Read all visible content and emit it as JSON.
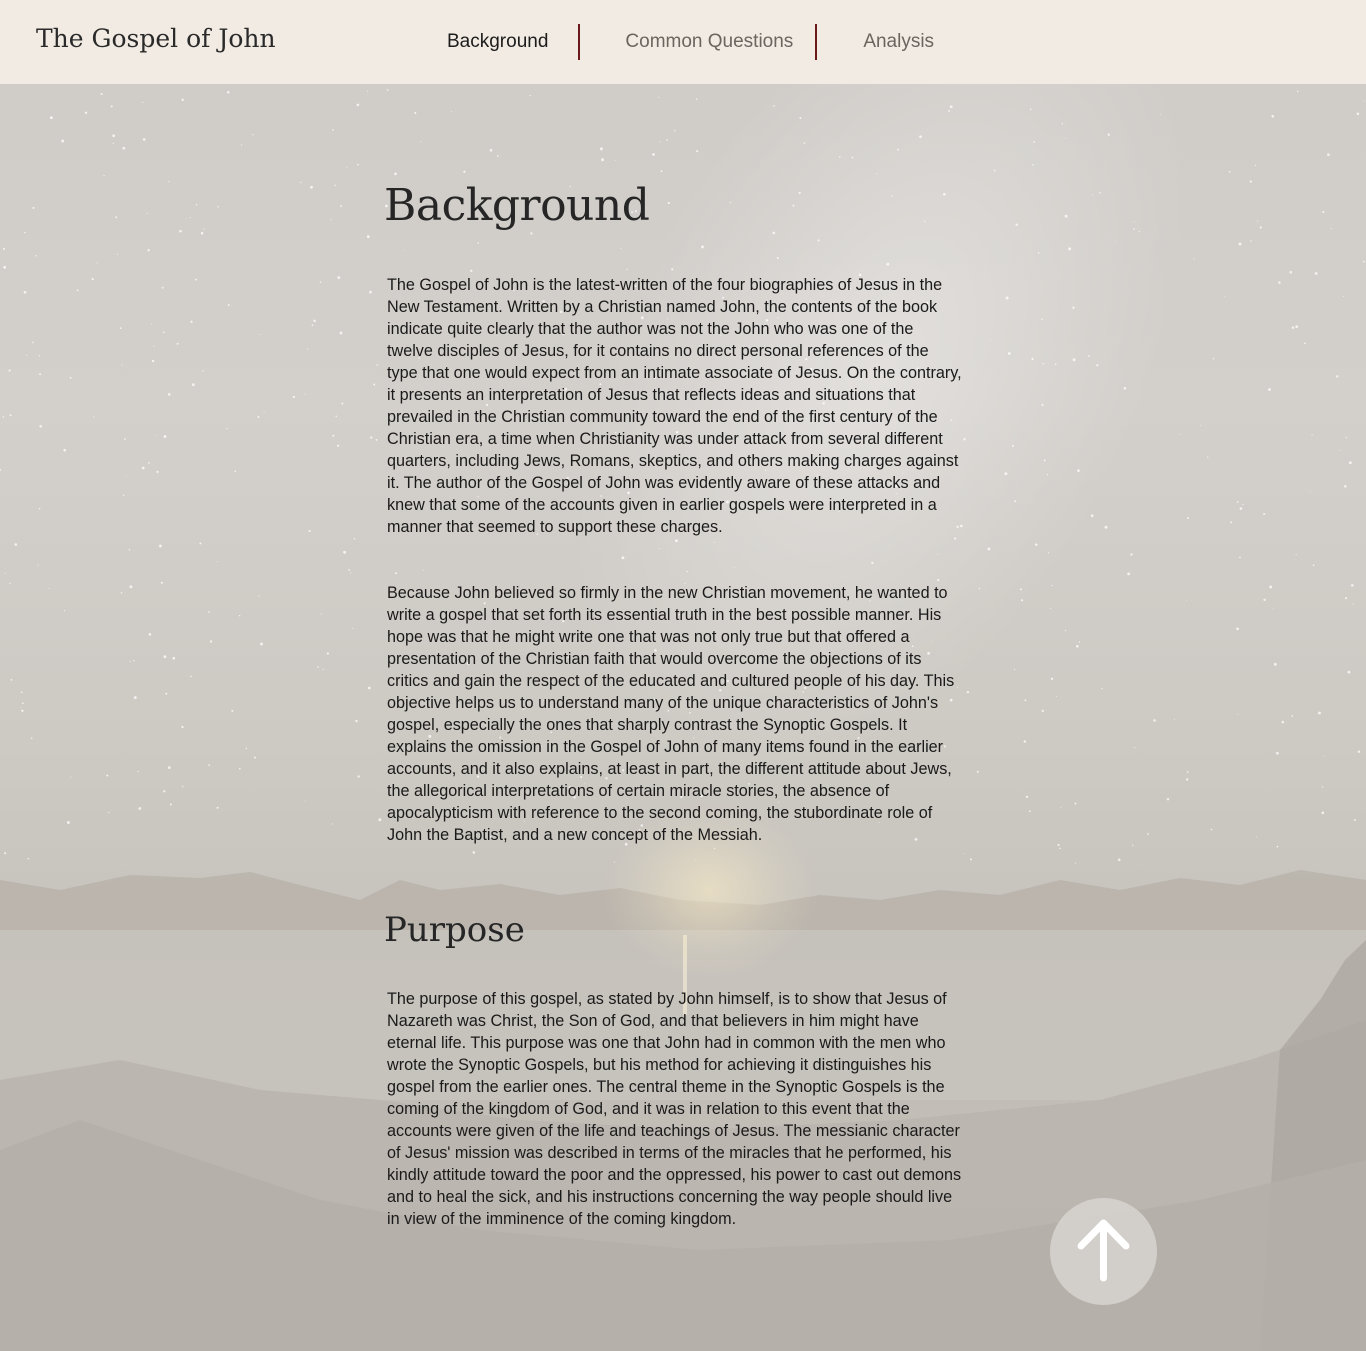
{
  "header": {
    "site_title": "The Gospel of John",
    "nav": [
      {
        "label": "Background",
        "active": true
      },
      {
        "label": "Common Questions",
        "active": false
      },
      {
        "label": "Analysis",
        "active": false
      }
    ]
  },
  "main": {
    "heading": "Background",
    "paragraphs": [
      "The Gospel of John is the latest-written of the four biographies of Jesus in the New Testament. Written by a Christian named John, the contents of the book indicate quite clearly that the author was not the John who was one of the twelve disciples of Jesus, for it contains no direct personal references of the type that one would expect from an intimate associate of Jesus. On the contrary, it presents an interpretation of Jesus that reflects ideas and situations that prevailed in the Christian community toward the end of the first century of the Christian era, a time when Christianity was under attack from several different quarters, including Jews, Romans, skeptics, and others making charges against it. The author of the Gospel of John was evidently aware of these attacks and knew that some of the accounts given in earlier gospels were interpreted in a manner that seemed to support these charges.",
      "Because John believed so firmly in the new Christian movement, he wanted to write a gospel that set forth its essential truth in the best possible manner. His hope was that he might write one that was not only true but that offered a presentation of the Christian faith that would overcome the objections of its critics and gain the respect of the educated and cultured people of his day. This objective helps us to understand many of the unique characteristics of John's gospel, especially the ones that sharply contrast the Synoptic Gospels. It explains the omission in the Gospel of John of many items found in the earlier accounts, and it also explains, at least in part, the different attitude about Jews, the allegorical interpretations of certain miracle stories, the absence of apocalypticism with reference to the second coming, the stubordinate role of John the Baptist, and a new concept of the Messiah."
    ],
    "purpose_heading": "Purpose",
    "purpose_paragraph": "The purpose of this gospel, as stated by John himself, is to show that Jesus of Nazareth was Christ, the Son of God, and that believers in him might have eternal life. This purpose was one that John had in common with the men who wrote the Synoptic Gospels, but his method for achieving it distinguishes his gospel from the earlier ones. The central theme in the Synoptic Gospels is the coming of the kingdom of God, and it was in relation to this event that the accounts were given of the life and teachings of Jesus. The messianic character of Jesus' mission was described in terms of the miracles that he performed, his kindly attitude toward the poor and the oppressed, his power to cast out demons and to heal the sick, and his instructions concerning the way people should live in view of the imminence of the coming kingdom."
  },
  "scroll_top": {
    "icon": "arrow-up-icon"
  },
  "colors": {
    "header_bg": "#f2ebe3",
    "nav_separator": "#6a1a1a",
    "text": "#1a1a1a"
  }
}
